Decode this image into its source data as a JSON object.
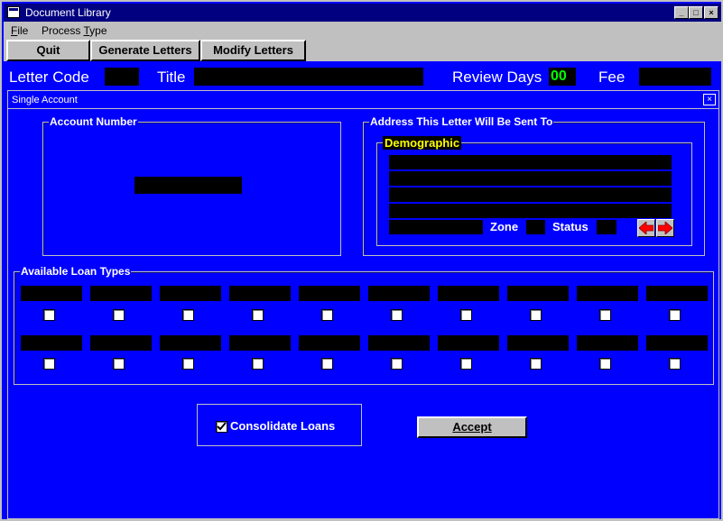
{
  "window": {
    "title": "Document Library"
  },
  "titlebar_buttons": {
    "minimize": "_",
    "maximize": "□",
    "close": "×"
  },
  "menu": {
    "file": {
      "label": "File",
      "underline": "F",
      "rest": "ile"
    },
    "process_type": {
      "label": "Process Type",
      "pre": "Process ",
      "underline": "T",
      "rest": "ype"
    }
  },
  "toolbar": {
    "quit": "Quit",
    "generate": "Generate Letters",
    "modify": "Modify Letters"
  },
  "info": {
    "letter_code_label": "Letter Code",
    "title_label": "Title",
    "review_days_label": "Review Days",
    "review_days_value": "00",
    "fee_label": "Fee"
  },
  "dialog": {
    "title": "Single Account",
    "close": "×",
    "account_number_label": "Account Number",
    "address_label": "Address This Letter Will Be Sent To",
    "demographic_label": "Demographic",
    "zone_label": "Zone",
    "status_label": "Status",
    "loan_types_label": "Available Loan Types",
    "consolidate_label": "Consolidate Loans",
    "consolidate_checked": true,
    "accept_label": "Accept"
  },
  "colors": {
    "background": "#0000ff",
    "field": "#000000",
    "review_value": "#00ff00",
    "demographic": "#ffff00",
    "arrow": "#ff0000"
  }
}
